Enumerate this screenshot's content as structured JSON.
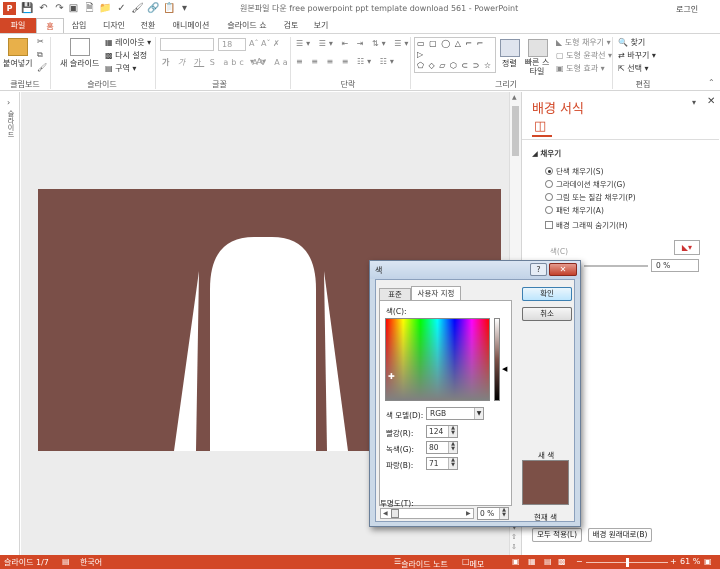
{
  "window": {
    "title": "원본파일 다운 free powerpoint ppt template download 561 - PowerPoint",
    "login": "로그인"
  },
  "tabs": [
    "파일",
    "홈",
    "삽입",
    "디자인",
    "전환",
    "애니메이션",
    "슬라이드 쇼",
    "검토",
    "보기"
  ],
  "ribbon": {
    "clipboard": {
      "paste": "붙여넣기",
      "group": "클립보드"
    },
    "slides": {
      "new_slide": "새 슬라이드",
      "layout": "레이아웃",
      "reset": "다시 설정",
      "section": "구역",
      "group": "슬라이드"
    },
    "font": {
      "size": "18",
      "group": "글꼴"
    },
    "paragraph": {
      "group": "단락"
    },
    "drawing": {
      "arrange": "정렬",
      "quick_styles": "빠른 스타일",
      "fill": "도형 채우기",
      "outline": "도형 윤곽선",
      "effects": "도형 효과",
      "group": "그리기"
    },
    "editing": {
      "find": "찾기",
      "replace": "바꾸기",
      "select": "선택",
      "group": "편집"
    }
  },
  "left_panel": {
    "label": "슬라이드"
  },
  "format_pane": {
    "title": "배경 서식",
    "section": "채우기",
    "options": [
      "단색 채우기(S)",
      "그라데이션 채우기(G)",
      "그림 또는 질감 채우기(P)",
      "패턴 채우기(A)"
    ],
    "hide_graphics": "배경 그래픽 숨기기(H)",
    "color_label": "색(C)",
    "transparency_value": "0 %",
    "apply_all": "모두 적용(L)",
    "reset_bg": "배경 원래대로(B)"
  },
  "dialog": {
    "title": "색",
    "tabs": [
      "표준",
      "사용자 지정"
    ],
    "ok": "확인",
    "cancel": "취소",
    "colors_label": "색(C):",
    "model_label": "색 모델(D):",
    "model_value": "RGB",
    "red_label": "빨강(R):",
    "red": "124",
    "green_label": "녹색(G):",
    "green": "80",
    "blue_label": "파랑(B):",
    "blue": "71",
    "new_label": "새 색",
    "current_label": "현재 색",
    "transparency_label": "투명도(T):",
    "transparency_value": "0 %",
    "new_color": "#7c5047"
  },
  "status": {
    "slide": "슬라이드 1/7",
    "language": "한국어",
    "notes": "슬라이드 노트",
    "comments": "메모",
    "zoom": "61 %"
  },
  "colors": {
    "accent": "#d24726",
    "slide_bg": "#7a4f48"
  }
}
